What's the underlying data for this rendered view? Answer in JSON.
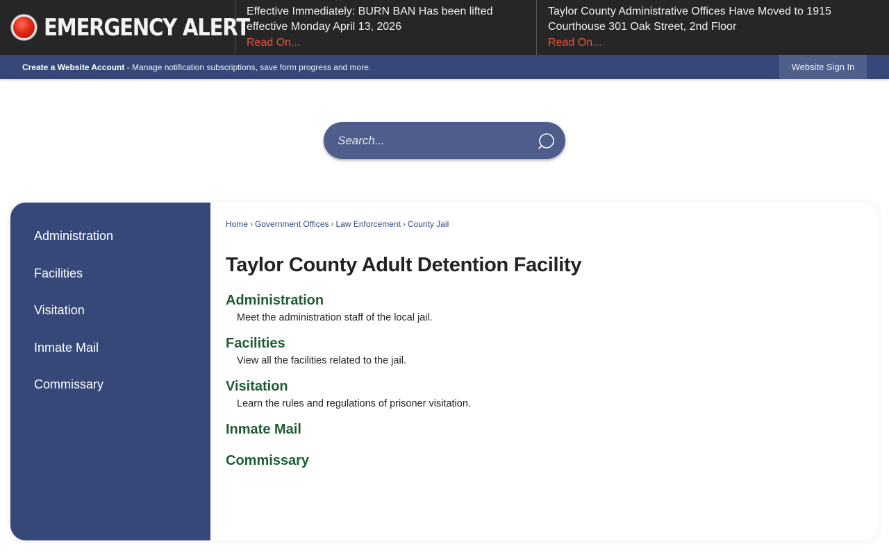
{
  "alert": {
    "title": "EMERGENCY ALERT",
    "items": [
      {
        "message": "Effective Immediately: BURN BAN Has been lifted effective Monday April 13, 2026",
        "link_label": "Read On..."
      },
      {
        "message": "Taylor County Administrative Offices Have Moved to 1915 Courthouse 301 Oak Street, 2nd Floor",
        "link_label": "Read On..."
      }
    ]
  },
  "account_bar": {
    "create_label": "Create a Website Account",
    "description": " - Manage notification subscriptions, save form progress and more.",
    "sign_in_label": "Website Sign In"
  },
  "search": {
    "placeholder": "Search..."
  },
  "side_nav": {
    "items": [
      {
        "label": "Administration"
      },
      {
        "label": "Facilities"
      },
      {
        "label": "Visitation"
      },
      {
        "label": "Inmate Mail"
      },
      {
        "label": "Commissary"
      }
    ]
  },
  "breadcrumb": {
    "items": [
      {
        "label": "Home"
      },
      {
        "label": "Government Offices"
      },
      {
        "label": "Law Enforcement"
      },
      {
        "label": "County Jail"
      }
    ],
    "separator": "›"
  },
  "page": {
    "title": "Taylor County Adult Detention Facility",
    "sections": [
      {
        "title": "Administration",
        "description": "Meet the administration staff of the local jail."
      },
      {
        "title": "Facilities",
        "description": "View all the facilities related to the jail."
      },
      {
        "title": "Visitation",
        "description": "Learn the rules and regulations of prisoner visitation."
      },
      {
        "title": "Inmate Mail",
        "description": ""
      },
      {
        "title": "Commissary",
        "description": ""
      }
    ]
  },
  "colors": {
    "alert_background": "#262626",
    "alert_link": "#e8523c",
    "brand_blue": "#374878",
    "section_link_green": "#1e5c32"
  }
}
